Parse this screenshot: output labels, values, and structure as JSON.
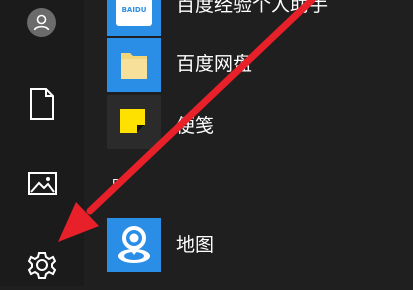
{
  "left_rail": {
    "items": [
      {
        "name": "account",
        "icon": "user-icon"
      },
      {
        "name": "documents",
        "icon": "document-icon"
      },
      {
        "name": "pictures",
        "icon": "picture-icon"
      },
      {
        "name": "settings",
        "icon": "gear-icon"
      }
    ]
  },
  "app_list": {
    "items": [
      {
        "label": "百度经验个人助手",
        "icon": "baidu-experience-icon",
        "tile_text": "BAIDU",
        "tile_color": "#2b8ee6"
      },
      {
        "label": "百度网盘",
        "icon": "folder-icon",
        "tile_color": "#2b8ee6"
      },
      {
        "label": "便笺",
        "icon": "sticky-note-icon",
        "tile_color": "#2b2b2b"
      },
      {
        "label": "地图",
        "icon": "maps-icon",
        "tile_color": "#2b8ee6"
      }
    ],
    "section_letter": "D"
  },
  "annotation": {
    "arrow_color": "#e8202a",
    "points_to": "settings"
  }
}
